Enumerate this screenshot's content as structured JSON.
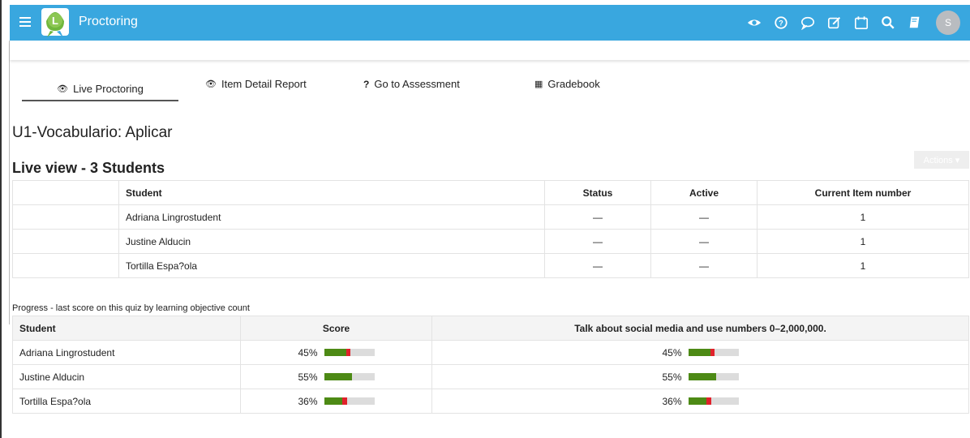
{
  "app": {
    "title": "Proctoring",
    "avatar_initial": "S",
    "brand_color": "#39a7df"
  },
  "top_icons": [
    "eye-icon",
    "help-icon",
    "chat-icon",
    "edit-icon",
    "calendar-icon",
    "search-icon",
    "book-icon"
  ],
  "tabs": [
    {
      "label": "Live Proctoring",
      "icon": "eye-icon",
      "glyph": "👁"
    },
    {
      "label": "Item Detail Report",
      "icon": "eye-icon",
      "glyph": "👁"
    },
    {
      "label": "Go to Assessment",
      "icon": "question-icon",
      "glyph": "?"
    },
    {
      "label": "Gradebook",
      "icon": "grid-icon",
      "glyph": "▦"
    }
  ],
  "assessment_title": "U1-Vocabulario: Aplicar",
  "live_view_title": "Live view - 3 Students",
  "actions_label": "Actions ▾",
  "live_table": {
    "headers": [
      "",
      "Student",
      "Status",
      "Active",
      "Current Item number"
    ],
    "rows": [
      {
        "student": "Adriana Lingrostudent",
        "status": "—",
        "active": "—",
        "item": "1"
      },
      {
        "student": "Justine Alducin",
        "status": "—",
        "active": "—",
        "item": "1"
      },
      {
        "student": "Tortilla Espa?ola",
        "status": "—",
        "active": "—",
        "item": "1"
      }
    ]
  },
  "progress_caption": "Progress - last score on this quiz by learning objective count",
  "progress_table": {
    "headers": [
      "Student",
      "Score",
      "Talk about social media and use numbers 0–2,000,000."
    ],
    "rows": [
      {
        "student": "Adriana Lingrostudent",
        "score": "45%",
        "score_green": 0.45,
        "score_red": 0.07,
        "obj": "45%",
        "obj_green": 0.45,
        "obj_red": 0.07
      },
      {
        "student": "Justine Alducin",
        "score": "55%",
        "score_green": 0.55,
        "score_red": 0,
        "obj": "55%",
        "obj_green": 0.55,
        "obj_red": 0
      },
      {
        "student": "Tortilla Espa?ola",
        "score": "36%",
        "score_green": 0.36,
        "score_red": 0.1,
        "obj": "36%",
        "obj_green": 0.36,
        "obj_red": 0.1
      }
    ]
  }
}
